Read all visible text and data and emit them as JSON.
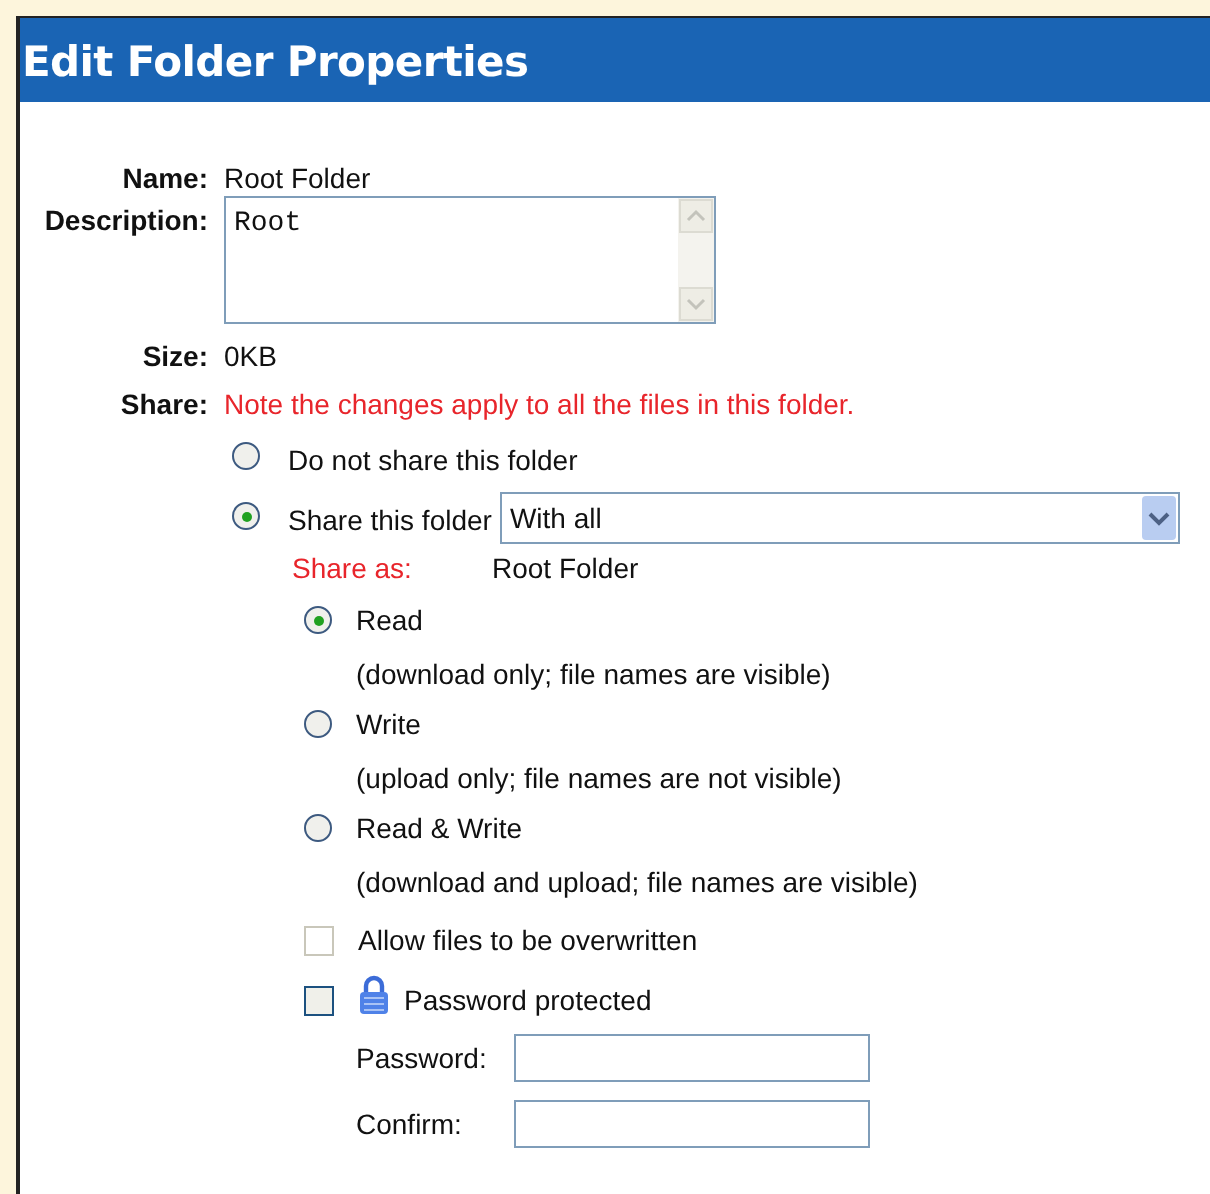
{
  "title": "Edit Folder Properties",
  "fields": [
    {
      "label": "Name:",
      "value": "Root Folder",
      "kind": "text"
    },
    {
      "label": "Description:",
      "value": "Root",
      "kind": "textarea"
    },
    {
      "label": "Size:",
      "value": "0KB",
      "kind": "text"
    }
  ],
  "share": {
    "label": "Share:",
    "note": "Note the changes apply to all the files in this folder.",
    "options": [
      {
        "label": "Do not share this folder",
        "selected": false
      },
      {
        "label": "Share this folder",
        "selected": true,
        "dropdown": "With all"
      }
    ],
    "share_as": {
      "label": "Share as:",
      "value": "Root Folder"
    },
    "permissions": [
      {
        "label": "Read",
        "hint": "(download only; file names are visible)",
        "selected": true
      },
      {
        "label": "Write",
        "hint": "(upload only; file names are not visible)",
        "selected": false
      },
      {
        "label": "Read & Write",
        "hint": "(download and upload; file names are visible)",
        "selected": false
      }
    ],
    "checkboxes": [
      {
        "label": "Allow files to be overwritten",
        "checked": false,
        "disabled": true,
        "kind": "plain"
      },
      {
        "label": "Password protected",
        "checked": false,
        "disabled": false,
        "kind": "locked"
      }
    ],
    "password_fields": [
      {
        "label": "Password:"
      },
      {
        "label": "Confirm:"
      }
    ]
  }
}
